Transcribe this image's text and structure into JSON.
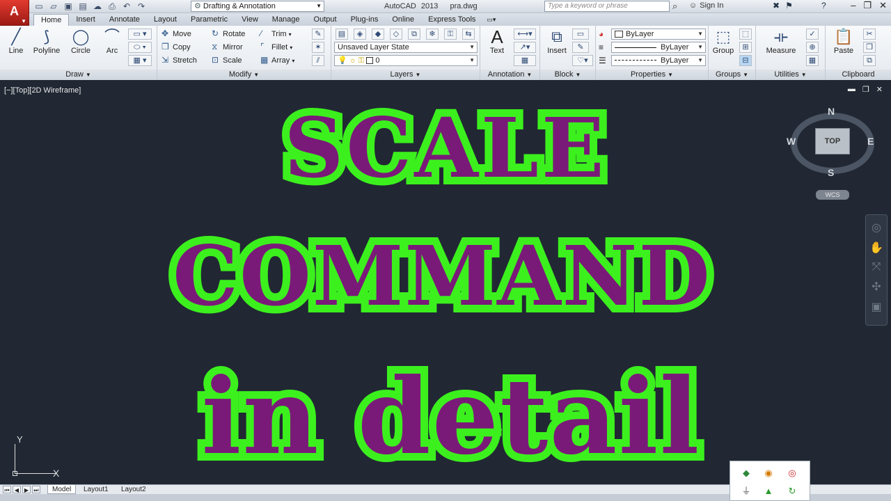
{
  "titlebar": {
    "app_logo": "A",
    "workspace": "Drafting & Annotation",
    "app_name": "AutoCAD 2013",
    "file_name": "pra.dwg",
    "search_placeholder": "Type a keyword or phrase",
    "sign_in": "Sign In"
  },
  "ribbon_tabs": [
    "Home",
    "Insert",
    "Annotate",
    "Layout",
    "Parametric",
    "View",
    "Manage",
    "Output",
    "Plug-ins",
    "Online",
    "Express Tools"
  ],
  "panels": {
    "draw": {
      "title": "Draw",
      "tools": [
        "Line",
        "Polyline",
        "Circle",
        "Arc"
      ]
    },
    "modify": {
      "title": "Modify",
      "tools": [
        "Move",
        "Rotate",
        "Trim",
        "Copy",
        "Mirror",
        "Fillet",
        "Stretch",
        "Scale",
        "Array"
      ]
    },
    "layers": {
      "title": "Layers",
      "layer_state": "Unsaved Layer State",
      "current_layer": "0"
    },
    "annotation": {
      "title": "Annotation",
      "text": "Text"
    },
    "block": {
      "title": "Block",
      "insert": "Insert"
    },
    "properties": {
      "title": "Properties",
      "color": "ByLayer",
      "linetype": "ByLayer",
      "lineweight": "ByLayer"
    },
    "groups": {
      "title": "Groups",
      "group": "Group"
    },
    "utilities": {
      "title": "Utilities",
      "measure": "Measure"
    },
    "clipboard": {
      "title": "Clipboard",
      "paste": "Paste"
    }
  },
  "viewport": {
    "label": "[−][Top][2D Wireframe]",
    "title_line1": "SCALE",
    "title_line2": "COMMAND",
    "title_line3": "in detail"
  },
  "viewcube": {
    "face": "TOP",
    "north": "N",
    "south": "S",
    "east": "E",
    "west": "W",
    "wcs": "WCS"
  },
  "ucs": {
    "x": "X",
    "y": "Y"
  },
  "layout_tabs": [
    "Model",
    "Layout1",
    "Layout2"
  ],
  "colors": {
    "title_fill": "#7a1a78",
    "title_outline": "#3cf01e",
    "canvas": "#212833"
  }
}
